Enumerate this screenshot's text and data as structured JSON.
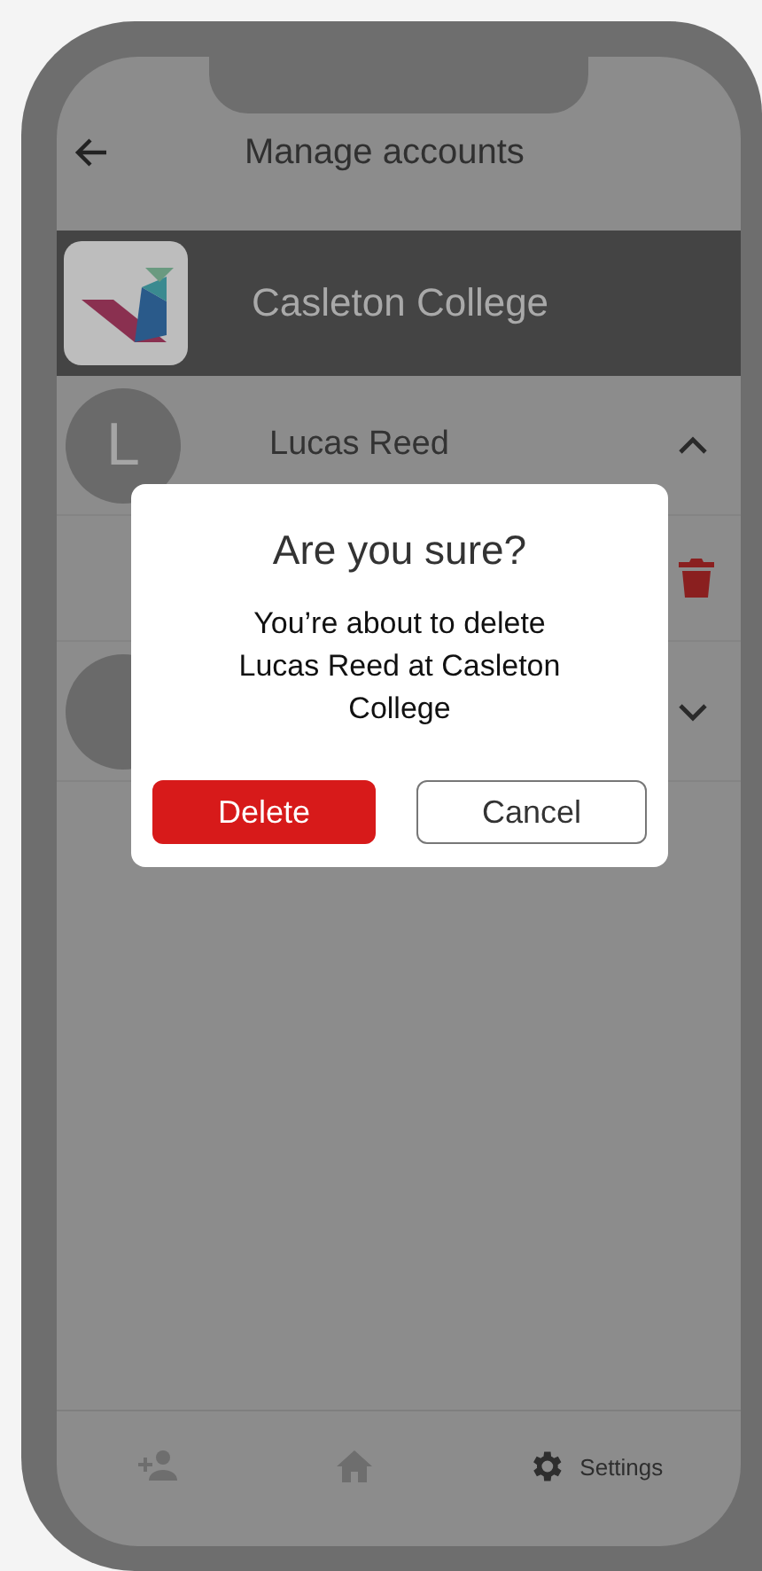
{
  "header": {
    "title": "Manage accounts"
  },
  "school": {
    "name": "Casleton College"
  },
  "users": [
    {
      "initial": "L",
      "name": "Lucas Reed",
      "expanded": true
    },
    {
      "expanded": false
    }
  ],
  "dialog": {
    "title": "Are you sure?",
    "message": "You’re about to delete Lucas Reed at Casleton College",
    "buttons": [
      {
        "label": "Delete",
        "kind": "danger"
      },
      {
        "label": "Cancel",
        "kind": "outline"
      }
    ]
  },
  "nav": [
    {
      "kind": "add-user",
      "selected": false
    },
    {
      "kind": "home",
      "selected": false
    },
    {
      "kind": "settings",
      "label": "Settings",
      "selected": true
    }
  ]
}
